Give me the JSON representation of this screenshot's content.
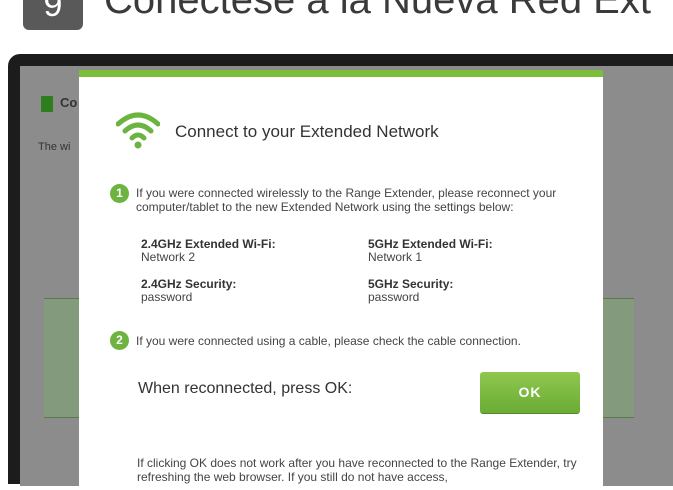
{
  "header": {
    "step_number": "9",
    "title": "Conectese a la Nueva Red Ext"
  },
  "background_page": {
    "section_title": "Co",
    "description": "The wi"
  },
  "dialog": {
    "title": "Connect to your Extended Network",
    "step1_number": "1",
    "step1_text": "If you were connected wirelessly to the Range Extender, please reconnect your computer/tablet to the new Extended Network using the settings below:",
    "networks": {
      "band24_label": "2.4GHz Extended Wi-Fi:",
      "band24_value": "Network 2",
      "band5_label": "5GHz Extended Wi-Fi:",
      "band5_value": "Network 1",
      "sec24_label": "2.4GHz Security:",
      "sec24_value": "password",
      "sec5_label": "5GHz Security:",
      "sec5_value": "password"
    },
    "step2_number": "2",
    "step2_text": "If you were connected using a cable, please check the cable connection.",
    "reconnect_prompt": "When reconnected, press OK:",
    "ok_label": "OK",
    "footnote": "If clicking OK does not work after you have reconnected to the Range Extender, try refreshing the web browser. If you still do not have access,"
  },
  "colors": {
    "accent_green": "#7cbd3a",
    "ok_button": "#6aac34",
    "step_badge": "#595959"
  }
}
